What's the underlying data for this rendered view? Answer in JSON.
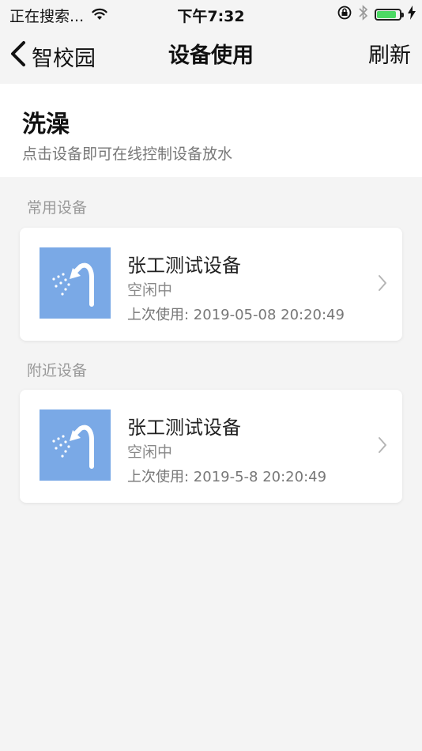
{
  "status_bar": {
    "carrier": "正在搜索...",
    "time": "下午7:32",
    "battery_level": 0.85,
    "icons": [
      "wifi-icon",
      "orientation-lock-icon",
      "bluetooth-icon",
      "battery-icon",
      "charging-icon"
    ]
  },
  "nav": {
    "back_label": "智校园",
    "title": "设备使用",
    "refresh_label": "刷新"
  },
  "header": {
    "title": "洗澡",
    "subtitle": "点击设备即可在线控制设备放水"
  },
  "sections": [
    {
      "label": "常用设备",
      "devices": [
        {
          "name": "张工测试设备",
          "status": "空闲中",
          "last_use": "上次使用: 2019-05-08 20:20:49",
          "icon": "shower-icon"
        }
      ]
    },
    {
      "label": "附近设备",
      "devices": [
        {
          "name": "张工测试设备",
          "status": "空闲中",
          "last_use": "上次使用: 2019-5-8 20:20:49",
          "icon": "shower-icon"
        }
      ]
    }
  ],
  "colors": {
    "background": "#f4f4f4",
    "card": "#ffffff",
    "thumb": "#7aa9e6",
    "battery": "#4cd964"
  }
}
